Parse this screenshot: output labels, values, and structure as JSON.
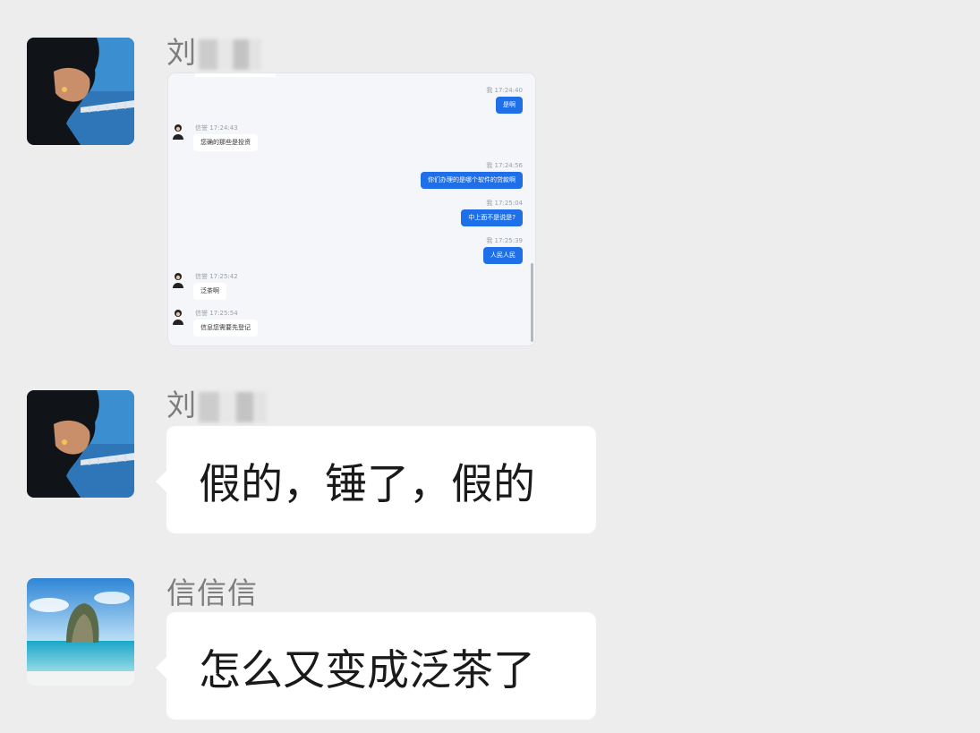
{
  "messages": [
    {
      "sender": "刘",
      "type": "image"
    },
    {
      "sender": "刘",
      "text": "假的，锤了，假的"
    },
    {
      "sender": "信信信",
      "text": "怎么又变成泛茶了"
    }
  ],
  "embedded_chat": {
    "items": [
      {
        "side": "right",
        "meta": "我 17:24:40",
        "text": "是啊"
      },
      {
        "side": "left",
        "meta": "信誉 17:24:43",
        "text": "您确的那些是投资"
      },
      {
        "side": "right",
        "meta": "我 17:24:56",
        "text": "你们办理的是哪个软件的贷款啊"
      },
      {
        "side": "right",
        "meta": "我 17:25:04",
        "text": "中上面不是说是?"
      },
      {
        "side": "right",
        "meta": "我 17:25:39",
        "text": "人民人民"
      },
      {
        "side": "left",
        "meta": "信誉 17:25:42",
        "text": "泛茶啊"
      },
      {
        "side": "left",
        "meta": "信誉 17:25:54",
        "text": "信息您需要先登记"
      }
    ]
  },
  "colors": {
    "background": "#ededed",
    "bubble": "#ffffff",
    "embedded_blue": "#1e6fe8"
  }
}
